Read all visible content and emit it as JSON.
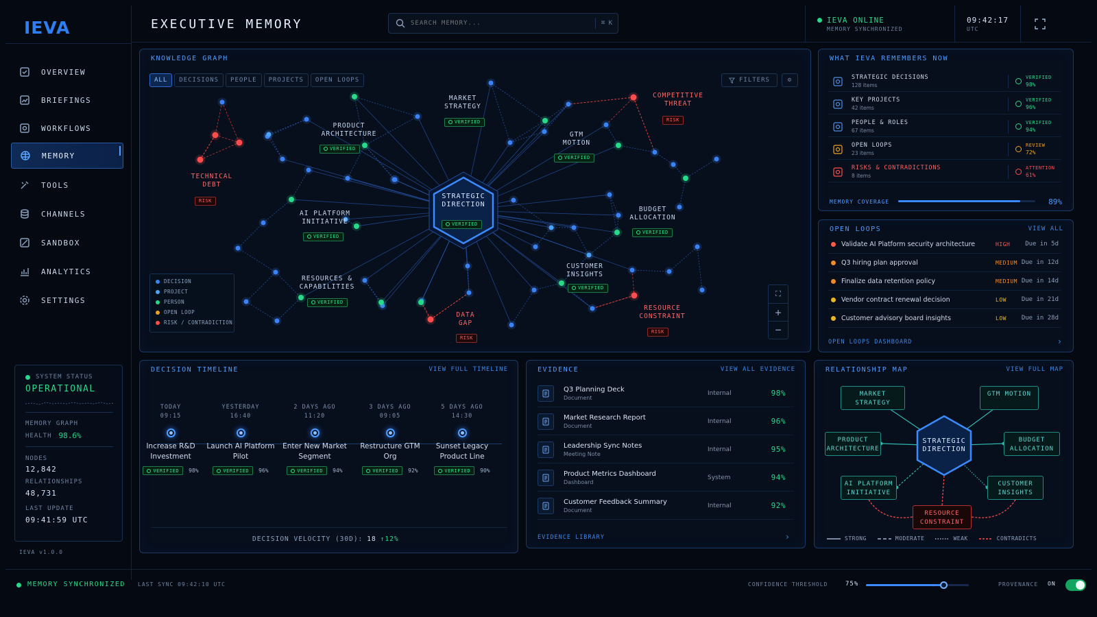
{
  "app": {
    "logo": "IEVA",
    "version": "IEVA v1.0.0"
  },
  "nav": [
    {
      "label": "OVERVIEW",
      "icon": "square-check-icon"
    },
    {
      "label": "BRIEFINGS",
      "icon": "chart-box-icon"
    },
    {
      "label": "WORKFLOWS",
      "icon": "workflow-icon"
    },
    {
      "label": "MEMORY",
      "icon": "brain-icon",
      "active": true
    },
    {
      "label": "TOOLS",
      "icon": "tools-icon"
    },
    {
      "label": "CHANNELS",
      "icon": "channels-icon"
    },
    {
      "label": "SANDBOX",
      "icon": "sandbox-icon"
    },
    {
      "label": "ANALYTICS",
      "icon": "analytics-icon"
    },
    {
      "label": "SETTINGS",
      "icon": "gear-icon"
    }
  ],
  "system": {
    "label": "SYSTEM STATUS",
    "status": "OPERATIONAL",
    "health_label1": "MEMORY GRAPH",
    "health_label2": "HEALTH",
    "health": "98.6%",
    "nodes_label": "NODES",
    "nodes": "12,842",
    "rel_label": "RELATIONSHIPS",
    "rel": "48,731",
    "update_label": "LAST UPDATE",
    "update": "09:41:59 UTC"
  },
  "header": {
    "title": "EXECUTIVE MEMORY",
    "search_placeholder": "SEARCH MEMORY...",
    "shortcut": "⌘ K",
    "online": "IEVA ONLINE",
    "online_sub": "MEMORY SYNCHRONIZED",
    "time": "09:42:17",
    "tz": "UTC"
  },
  "graph": {
    "title": "KNOWLEDGE GRAPH",
    "filters": [
      "ALL",
      "DECISIONS",
      "PEOPLE",
      "PROJECTS",
      "OPEN LOOPS"
    ],
    "filters_btn": "FILTERS",
    "verified": "VERIFIED",
    "risk": "RISK",
    "center": "STRATEGIC\nDIRECTION",
    "labels": {
      "market": "MARKET\nSTRATEGY",
      "product": "PRODUCT\nARCHITECTURE",
      "gtm": "GTM\nMOTION",
      "threat": "COMPETITIVE\nTHREAT",
      "debt": "TECHNICAL\nDEBT",
      "ai": "AI PLATFORM\nINITIATIVE",
      "budget": "BUDGET\nALLOCATION",
      "resources": "RESOURCES &\nCAPABILITIES",
      "customer": "CUSTOMER\nINSIGHTS",
      "gap": "DATA\nGAP",
      "constraint": "RESOURCE\nCONSTRAINT"
    },
    "legend": [
      {
        "label": "DECISION",
        "color": "#3b82f6"
      },
      {
        "label": "PROJECT",
        "color": "#4da3ff"
      },
      {
        "label": "PERSON",
        "color": "#27d98a"
      },
      {
        "label": "OPEN LOOP",
        "color": "#f0a020"
      },
      {
        "label": "RISK / CONTRADICTION",
        "color": "#ff4d4d"
      }
    ]
  },
  "remembers": {
    "title": "WHAT IEVA REMEMBERS NOW",
    "rows": [
      {
        "name": "STRATEGIC DECISIONS",
        "count": "128 items",
        "status": "VERIFIED",
        "pct": "98%",
        "color": "#27d98a",
        "icon": "decision-icon"
      },
      {
        "name": "KEY PROJECTS",
        "count": "42 items",
        "status": "VERIFIED",
        "pct": "96%",
        "color": "#27d98a",
        "icon": "document-icon"
      },
      {
        "name": "PEOPLE & ROLES",
        "count": "67 items",
        "status": "VERIFIED",
        "pct": "94%",
        "color": "#27d98a",
        "icon": "person-icon"
      },
      {
        "name": "OPEN LOOPS",
        "count": "23 items",
        "status": "REVIEW",
        "pct": "72%",
        "color": "#f0a020",
        "icon": "loop-icon"
      },
      {
        "name": "RISKS & CONTRADICTIONS",
        "count": "8 items",
        "status": "ATTENTION",
        "pct": "61%",
        "color": "#ff4d4d",
        "icon": "alert-icon"
      }
    ],
    "coverage_label": "MEMORY COVERAGE",
    "coverage": "89%",
    "coverage_value": 0.89
  },
  "loops": {
    "title": "OPEN LOOPS",
    "link": "VIEW ALL",
    "footer": "OPEN LOOPS DASHBOARD",
    "rows": [
      {
        "text": "Validate AI Platform security architecture",
        "priority": "HIGH",
        "due": "Due in 5d",
        "color": "#ff5a4a"
      },
      {
        "text": "Q3 hiring plan approval",
        "priority": "MEDIUM",
        "due": "Due in 12d",
        "color": "#f08a2a"
      },
      {
        "text": "Finalize data retention policy",
        "priority": "MEDIUM",
        "due": "Due in 14d",
        "color": "#f08a2a"
      },
      {
        "text": "Vendor contract renewal decision",
        "priority": "LOW",
        "due": "Due in 21d",
        "color": "#e8b820"
      },
      {
        "text": "Customer advisory board insights",
        "priority": "LOW",
        "due": "Due in 28d",
        "color": "#e8b820"
      }
    ]
  },
  "timeline": {
    "title": "DECISION TIMELINE",
    "link": "VIEW FULL TIMELINE",
    "items": [
      {
        "when": "TODAY",
        "time": "09:15",
        "name": "Increase R&D\nInvestment",
        "pct": "98%"
      },
      {
        "when": "YESTERDAY",
        "time": "16:40",
        "name": "Launch AI Platform\nPilot",
        "pct": "96%"
      },
      {
        "when": "2 DAYS AGO",
        "time": "11:20",
        "name": "Enter New Market\nSegment",
        "pct": "94%"
      },
      {
        "when": "3 DAYS AGO",
        "time": "09:05",
        "name": "Restructure GTM\nOrg",
        "pct": "92%"
      },
      {
        "when": "5 DAYS AGO",
        "time": "14:30",
        "name": "Sunset Legacy\nProduct Line",
        "pct": "90%"
      }
    ],
    "velocity_label": "DECISION VELOCITY (30D):",
    "velocity": "18",
    "velocity_change": "↑12%"
  },
  "evidence": {
    "title": "EVIDENCE",
    "link": "VIEW ALL EVIDENCE",
    "footer": "EVIDENCE LIBRARY",
    "rows": [
      {
        "name": "Q3 Planning Deck",
        "type": "Document",
        "source": "Internal",
        "pct": "98%",
        "icon": "deck-icon"
      },
      {
        "name": "Market Research Report",
        "type": "Document",
        "source": "Internal",
        "pct": "96%",
        "icon": "document-icon"
      },
      {
        "name": "Leadership Sync Notes",
        "type": "Meeting Note",
        "source": "Internal",
        "pct": "95%",
        "icon": "notes-icon"
      },
      {
        "name": "Product Metrics Dashboard",
        "type": "Dashboard",
        "source": "System",
        "pct": "94%",
        "icon": "dashboard-icon"
      },
      {
        "name": "Customer Feedback Summary",
        "type": "Document",
        "source": "Internal",
        "pct": "92%",
        "icon": "document-icon"
      }
    ]
  },
  "relmap": {
    "title": "RELATIONSHIP MAP",
    "link": "VIEW FULL MAP",
    "center": "STRATEGIC\nDIRECTION",
    "nodes": {
      "market": "MARKET\nSTRATEGY",
      "gtm": "GTM\nMOTION",
      "product": "PRODUCT\nARCHITECTURE",
      "budget": "BUDGET\nALLOCATION",
      "ai": "AI PLATFORM\nINITIATIVE",
      "customer": "CUSTOMER\nINSIGHTS",
      "constraint": "RESOURCE\nCONSTRAINT"
    },
    "legend": [
      "STRONG",
      "MODERATE",
      "WEAK",
      "CONTRADICTS"
    ]
  },
  "footer": {
    "sync": "MEMORY SYNCHRONIZED",
    "last_sync": "LAST SYNC 09:42:10 UTC",
    "threshold_label": "CONFIDENCE THRESHOLD",
    "threshold": "75%",
    "threshold_value": 0.75,
    "provenance_label": "PROVENANCE",
    "provenance": "ON"
  }
}
